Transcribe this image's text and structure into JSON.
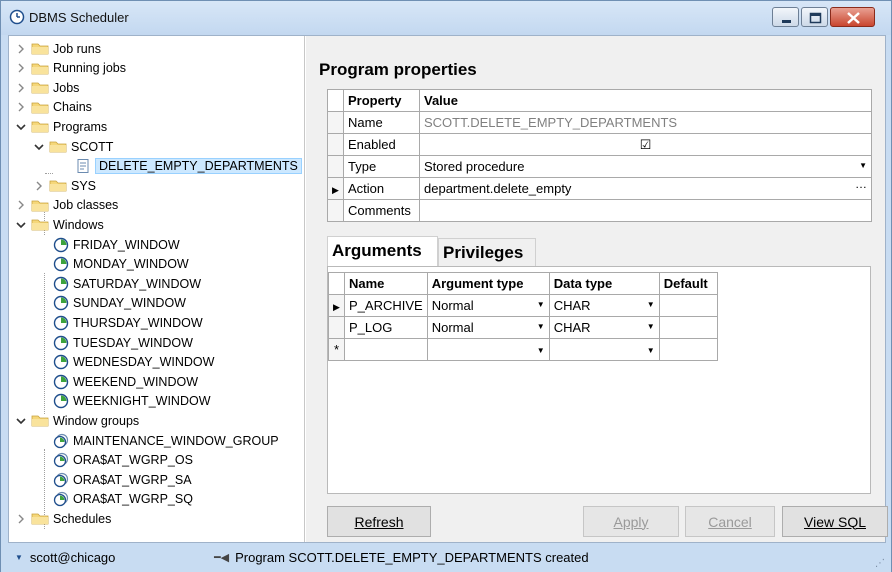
{
  "window": {
    "title": "DBMS Scheduler"
  },
  "tree": {
    "items": [
      {
        "label": "Job runs",
        "level": 0,
        "expanded": false
      },
      {
        "label": "Running jobs",
        "level": 0,
        "expanded": false
      },
      {
        "label": "Jobs",
        "level": 0,
        "expanded": false
      },
      {
        "label": "Chains",
        "level": 0,
        "expanded": false
      },
      {
        "label": "Programs",
        "level": 0,
        "expanded": true
      },
      {
        "label": "SCOTT",
        "level": 1,
        "expanded": true
      },
      {
        "label": "DELETE_EMPTY_DEPARTMENTS",
        "level": 2,
        "selected": true
      },
      {
        "label": "SYS",
        "level": 1,
        "expanded": false
      },
      {
        "label": "Job classes",
        "level": 0,
        "expanded": false
      },
      {
        "label": "Windows",
        "level": 0,
        "expanded": true
      }
    ],
    "windows": [
      "FRIDAY_WINDOW",
      "MONDAY_WINDOW",
      "SATURDAY_WINDOW",
      "SUNDAY_WINDOW",
      "THURSDAY_WINDOW",
      "TUESDAY_WINDOW",
      "WEDNESDAY_WINDOW",
      "WEEKEND_WINDOW",
      "WEEKNIGHT_WINDOW"
    ],
    "window_groups_label": "Window groups",
    "window_groups": [
      "MAINTENANCE_WINDOW_GROUP",
      "ORA$AT_WGRP_OS",
      "ORA$AT_WGRP_SA",
      "ORA$AT_WGRP_SQ"
    ],
    "schedules_label": "Schedules"
  },
  "properties": {
    "title": "Program properties",
    "header": {
      "property": "Property",
      "value": "Value"
    },
    "rows": [
      {
        "property": "Name",
        "value": "SCOTT.DELETE_EMPTY_DEPARTMENTS"
      },
      {
        "property": "Enabled",
        "value": "☑"
      },
      {
        "property": "Type",
        "value": "Stored procedure"
      },
      {
        "property": "Action",
        "value": "department.delete_empty"
      },
      {
        "property": "Comments",
        "value": ""
      }
    ],
    "ellipsis": "…"
  },
  "tabs": {
    "arguments": "Arguments",
    "privileges": "Privileges"
  },
  "arguments": {
    "headers": {
      "name": "Name",
      "argument_type": "Argument type",
      "data_type": "Data type",
      "default": "Default"
    },
    "rows": [
      {
        "name": "P_ARCHIVE",
        "argument_type": "Normal",
        "data_type": "CHAR",
        "default": ""
      },
      {
        "name": "P_LOG",
        "argument_type": "Normal",
        "data_type": "CHAR",
        "default": ""
      }
    ],
    "new_row_marker": "*"
  },
  "buttons": {
    "refresh": "Refresh",
    "apply": "Apply",
    "cancel": "Cancel",
    "view_sql": "View SQL"
  },
  "status": {
    "connection": "scott@chicago",
    "message": "Program SCOTT.DELETE_EMPTY_DEPARTMENTS created"
  },
  "colors": {
    "title_bar": "#c8dcf2",
    "selection": "#cce8ff",
    "folder": "#f5d77a",
    "clock_green": "#3da33d"
  }
}
